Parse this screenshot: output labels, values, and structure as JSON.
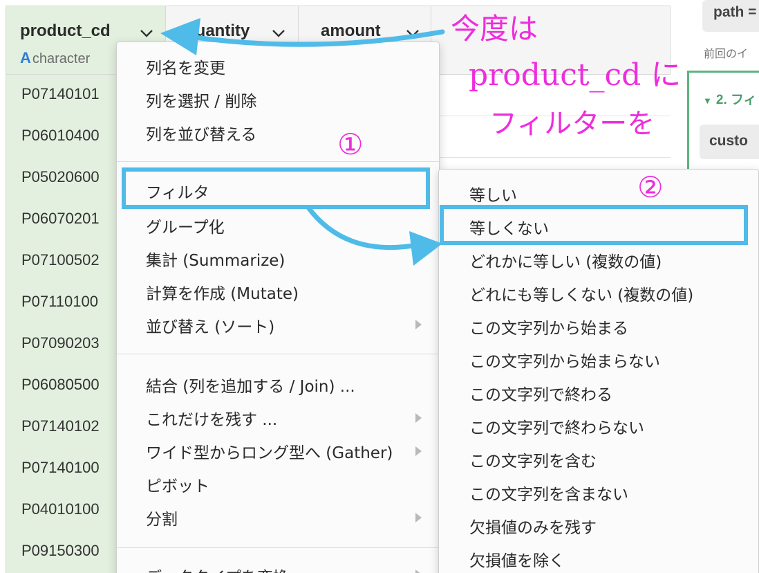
{
  "table": {
    "columns": [
      {
        "name": "product_cd",
        "type_badge": "A",
        "type": "character"
      },
      {
        "name": "quantity"
      },
      {
        "name": "amount"
      }
    ],
    "rows": [
      "P07140101",
      "P06010400",
      "P05020600",
      "P06070201",
      "P07100502",
      "P07110100",
      "P07090203",
      "P06080500",
      "P07140102",
      "P07140100",
      "P04010100",
      "P09150300"
    ]
  },
  "right_panel": {
    "path_label": "path =",
    "prev_note": "前回のイ",
    "step_title": "2. フィ",
    "custom_label": "custo"
  },
  "context_menu": {
    "items": [
      {
        "label": "列名を変更"
      },
      {
        "label": "列を選択 / 削除"
      },
      {
        "label": "列を並び替える"
      },
      {
        "label": "フィルタ",
        "submenu": true
      },
      {
        "label": "グループ化"
      },
      {
        "label": "集計 (Summarize)"
      },
      {
        "label": "計算を作成 (Mutate)"
      },
      {
        "label": "並び替え (ソート)",
        "submenu": true
      },
      {
        "label": "結合 (列を追加する / Join) ..."
      },
      {
        "label": "これだけを残す ...",
        "submenu": true
      },
      {
        "label": "ワイド型からロング型へ (Gather)",
        "submenu": true
      },
      {
        "label": "ピボット"
      },
      {
        "label": "分割",
        "submenu": true
      },
      {
        "label": "データタイプを変換",
        "submenu": true
      }
    ]
  },
  "filter_submenu": {
    "items": [
      "等しい",
      "等しくない",
      "どれかに等しい (複数の値)",
      "どれにも等しくない (複数の値)",
      "この文字列から始まる",
      "この文字列から始まらない",
      "この文字列で終わる",
      "この文字列で終わらない",
      "この文字列を含む",
      "この文字列を含まない",
      "欠損値のみを残す",
      "欠損値を除く"
    ]
  },
  "annotation": {
    "line1": "今度は",
    "line2": "product_cd に",
    "line3": "フィルターを",
    "step1": "①",
    "step2": "②",
    "color": "#ee2ddd",
    "highlight_color": "#4fbbe9"
  }
}
